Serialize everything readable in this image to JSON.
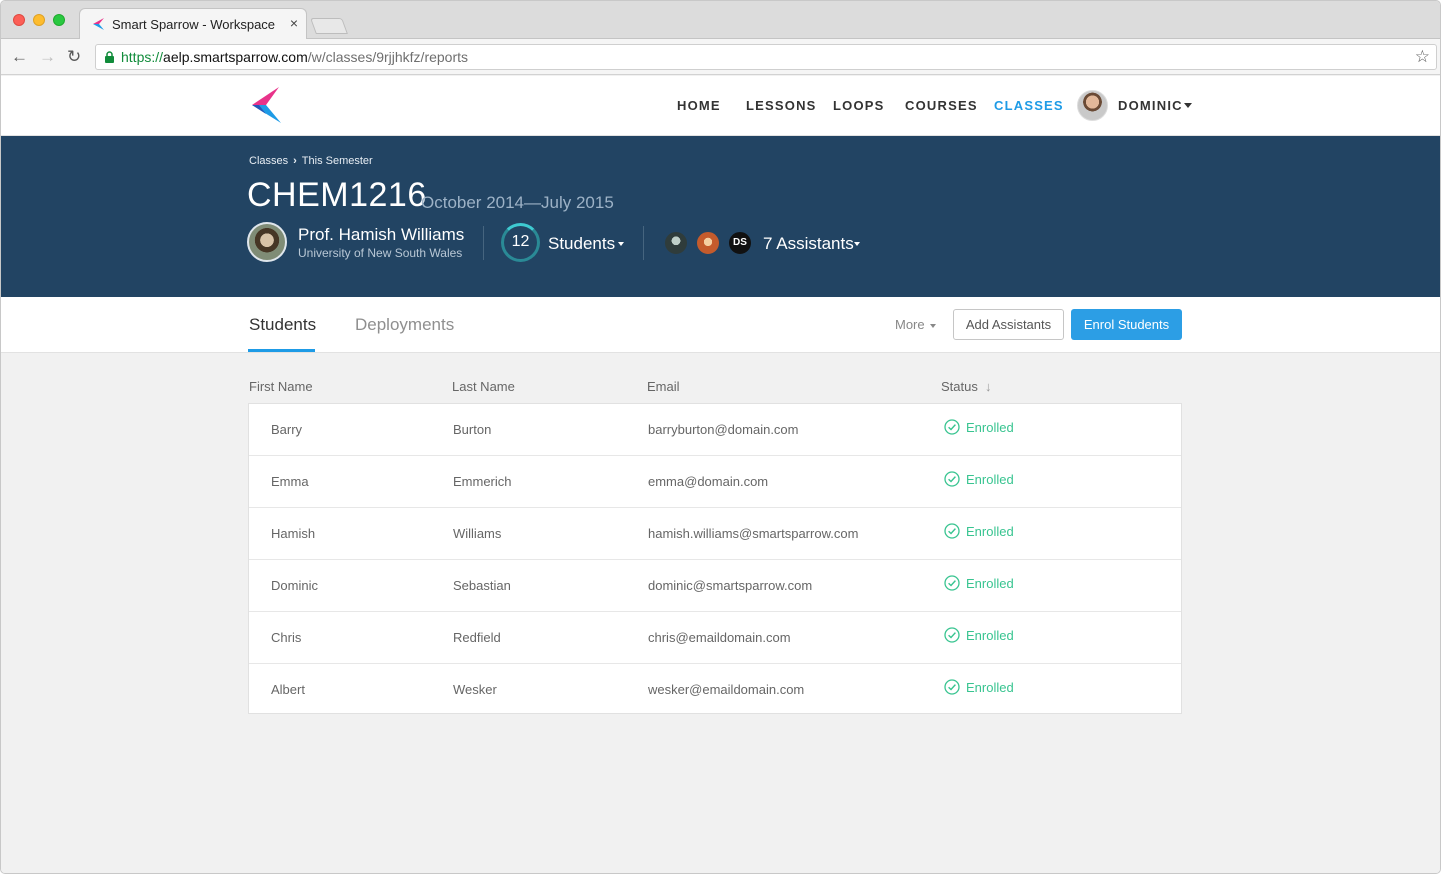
{
  "browser": {
    "tab_title": "Smart Sparrow - Workspace",
    "tab_close": "×",
    "url_protocol": "https://",
    "url_host": "aelp.smartsparrow.com",
    "url_path": "/w/classes/9rjjhkfz/reports"
  },
  "nav": {
    "items": [
      "HOME",
      "LESSONS",
      "LOOPS",
      "COURSES",
      "CLASSES"
    ],
    "active": "CLASSES",
    "user": "DOMINIC"
  },
  "colors": {
    "accent": "#1e9be6",
    "hero_bg": "#224463",
    "enrolled": "#38c490",
    "primary_button": "#2c9ee5"
  },
  "hero": {
    "breadcrumb": [
      "Classes",
      "This Semester"
    ],
    "course_code": "CHEM1216",
    "dates": "October 2014—July 2015",
    "instructor_name": "Prof. Hamish Williams",
    "instructor_org": "University of New South Wales",
    "student_count": "12",
    "students_label": "Students",
    "assistant_initials": "DS",
    "assistants_label": "7 Assistants"
  },
  "tabs": {
    "students": "Students",
    "deployments": "Deployments",
    "more": "More",
    "add_assistants": "Add Assistants",
    "enrol_students": "Enrol Students"
  },
  "table": {
    "headers": [
      "First Name",
      "Last Name",
      "Email",
      "Status"
    ],
    "rows": [
      {
        "first": "Barry",
        "last": "Burton",
        "email": "barryburton@domain.com",
        "status": "Enrolled"
      },
      {
        "first": "Emma",
        "last": "Emmerich",
        "email": "emma@domain.com",
        "status": "Enrolled"
      },
      {
        "first": "Hamish",
        "last": "Williams",
        "email": "hamish.williams@smartsparrow.com",
        "status": "Enrolled"
      },
      {
        "first": "Dominic",
        "last": "Sebastian",
        "email": "dominic@smartsparrow.com",
        "status": "Enrolled"
      },
      {
        "first": "Chris",
        "last": "Redfield",
        "email": "chris@emaildomain.com",
        "status": "Enrolled"
      },
      {
        "first": "Albert",
        "last": "Wesker",
        "email": "wesker@emaildomain.com",
        "status": "Enrolled"
      }
    ]
  }
}
